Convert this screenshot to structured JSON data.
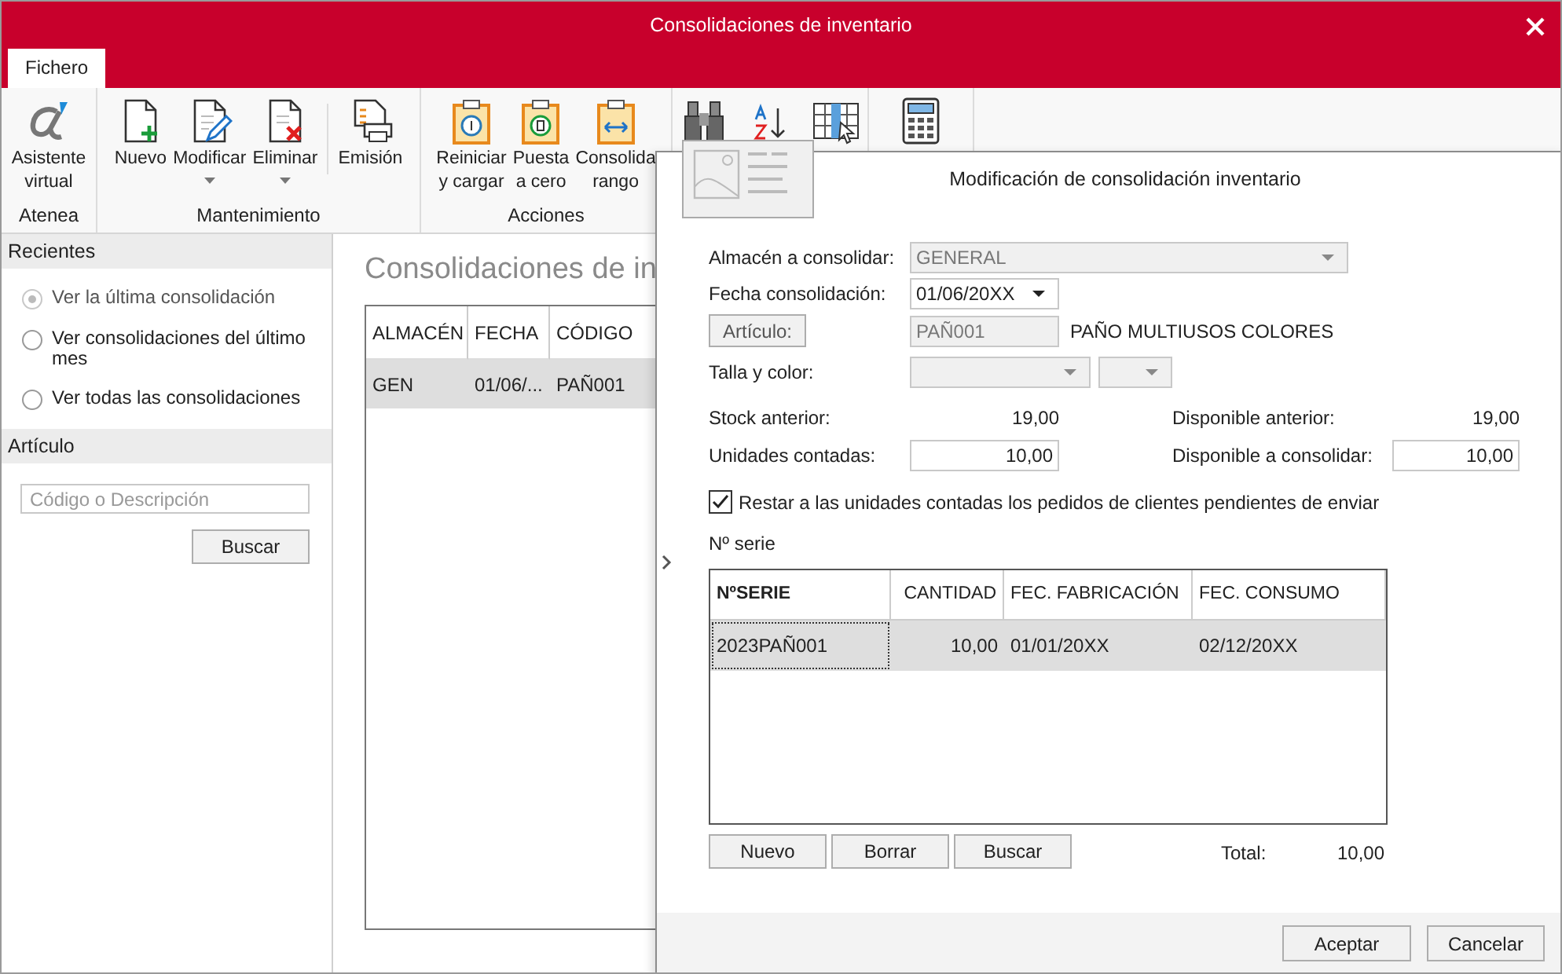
{
  "window": {
    "title": "Consolidaciones de inventario"
  },
  "menu_tabs": [
    {
      "label": "Fichero",
      "selected": true
    }
  ],
  "ribbon": [
    {
      "label": "Atenea",
      "buttons": [
        {
          "kind": "alpha",
          "label": "Asistente\nvirtual"
        }
      ]
    },
    {
      "label": "Mantenimiento",
      "buttons": [
        {
          "kind": "new",
          "label": "Nuevo"
        },
        {
          "kind": "edit",
          "label": "Modificar",
          "dropdown": true
        },
        {
          "kind": "delete",
          "label": "Eliminar",
          "dropdown": true
        },
        {
          "kind": "print",
          "label": "Emisión",
          "separator_before": true
        }
      ]
    },
    {
      "label": "Acciones",
      "buttons": [
        {
          "kind": "reload",
          "label": "Reiniciar\ny cargar"
        },
        {
          "kind": "reset",
          "label": "Puesta\na cero"
        },
        {
          "kind": "range",
          "label": "Consolida\nrango"
        }
      ]
    },
    {
      "buttons": [
        {
          "kind": "search"
        },
        {
          "kind": "sort"
        },
        {
          "kind": "columns"
        }
      ]
    },
    {
      "buttons": [
        {
          "kind": "calculator"
        }
      ]
    }
  ],
  "sidebar": [
    {
      "kind": "radios",
      "title": "Recientes",
      "options": [
        {
          "label": "Ver la última consolidación",
          "selected": true,
          "disabled": true
        },
        {
          "label": "Ver consolidaciones del último\nmes",
          "selected": false,
          "disabled": false
        },
        {
          "label": "Ver todas las consolidaciones",
          "selected": false,
          "disabled": false
        }
      ]
    },
    {
      "kind": "search",
      "title": "Artículo",
      "placeholder": "Código o Descripción",
      "button": "Buscar"
    }
  ],
  "main": {
    "heading": "Consolidaciones de in",
    "table": {
      "columns": [
        "ALMACÉN",
        "FECHA",
        "CÓDIGO"
      ],
      "rows": [
        {
          "cells": [
            "GEN",
            "01/06/...",
            "PAÑ001"
          ],
          "selected": true
        }
      ]
    }
  },
  "dialog": {
    "title": "Modificación de consolidación inventario",
    "almacen": {
      "label": "Almacén a consolidar:",
      "value": "GENERAL",
      "disabled": true
    },
    "fecha": {
      "label": "Fecha consolidación:",
      "value": "01/06/20XX"
    },
    "articulo": {
      "button": "Artículo:",
      "code": "PAÑ001",
      "description": "PAÑO MULTIUSOS COLORES"
    },
    "talla": {
      "label": "Talla y color:"
    },
    "stock": {
      "label": "Stock anterior:",
      "value": "19,00"
    },
    "disponible_anterior": {
      "label": "Disponible anterior:",
      "value": "19,00"
    },
    "unidades": {
      "label": "Unidades contadas:",
      "value": "10,00"
    },
    "disponible_consolidar": {
      "label": "Disponible a consolidar:",
      "value": "10,00"
    },
    "restar": {
      "label": "Restar a las unidades contadas los pedidos de clientes pendientes de enviar",
      "checked": true
    },
    "serie_label": "Nº serie",
    "serie_table": {
      "columns": [
        "NºSERIE",
        "CANTIDAD",
        "FEC. FABRICACIÓN",
        "FEC. CONSUMO"
      ],
      "rows": [
        {
          "cells": [
            "2023PAÑ001",
            "10,00",
            "01/01/20XX",
            "02/12/20XX"
          ],
          "selected": true
        }
      ]
    },
    "serie_buttons": [
      "Nuevo",
      "Borrar",
      "Buscar"
    ],
    "total": {
      "label": "Total:",
      "value": "10,00"
    },
    "footer_buttons": [
      "Aceptar",
      "Cancelar"
    ]
  }
}
